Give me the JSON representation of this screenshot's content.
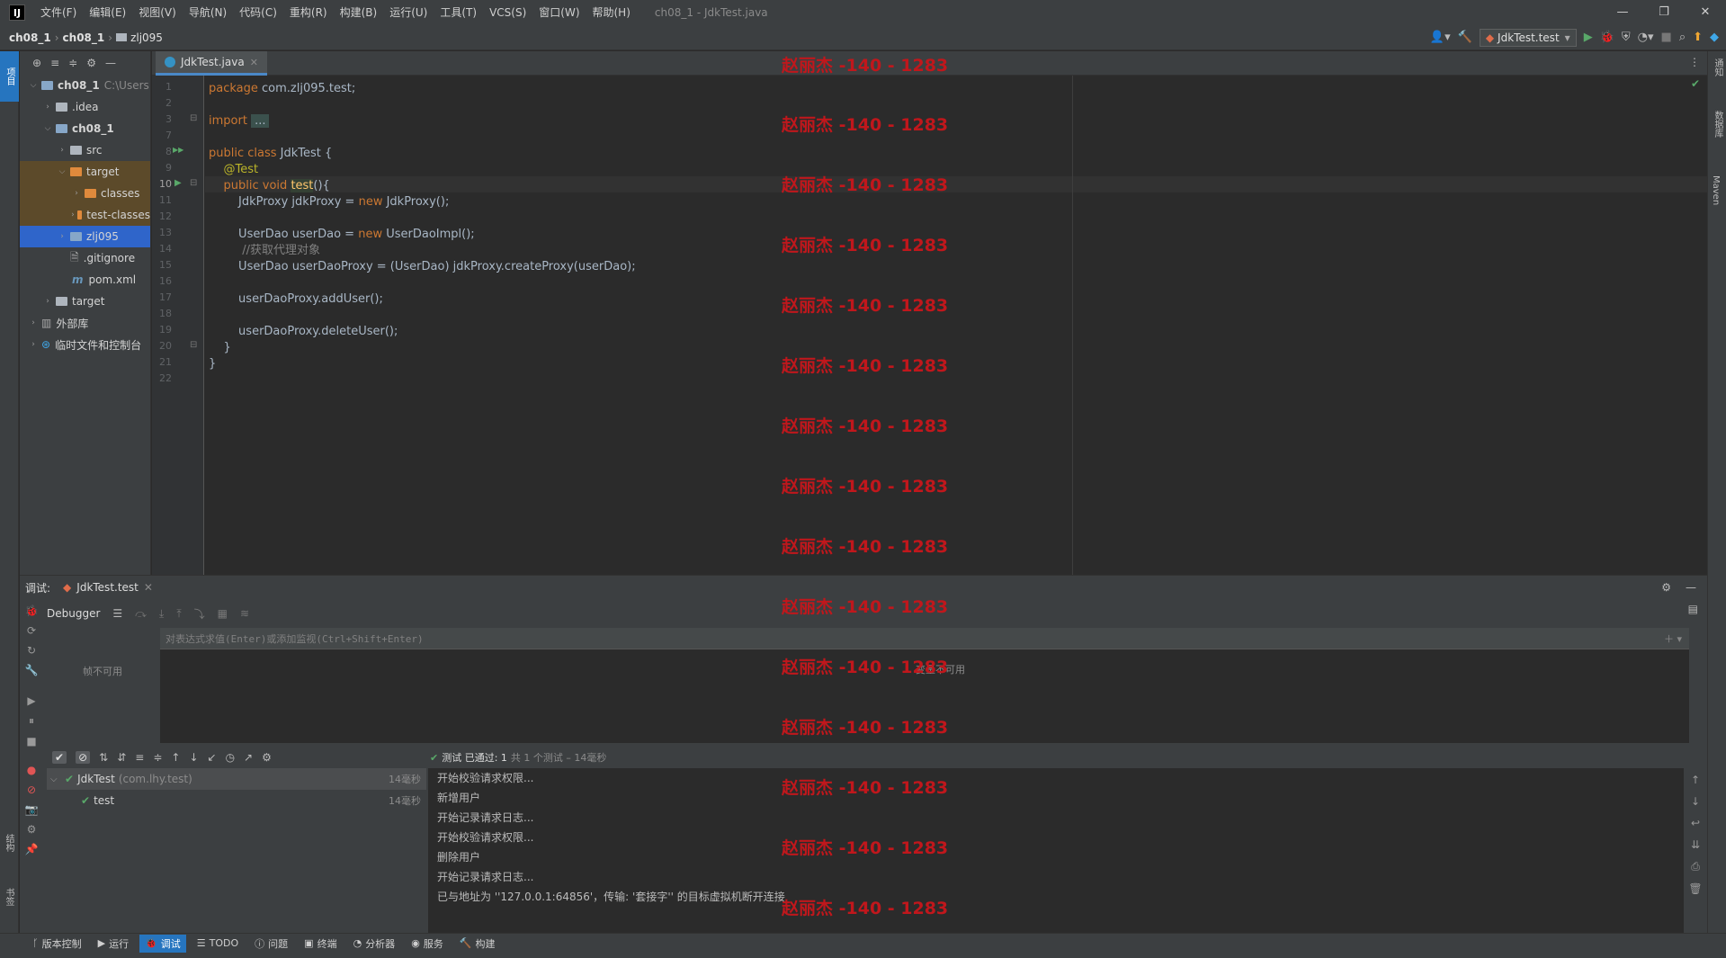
{
  "menu": {
    "items": [
      "文件(F)",
      "编辑(E)",
      "视图(V)",
      "导航(N)",
      "代码(C)",
      "重构(R)",
      "构建(B)",
      "运行(U)",
      "工具(T)",
      "VCS(S)",
      "窗口(W)",
      "帮助(H)"
    ],
    "window_title": "ch08_1 - JdkTest.java",
    "logo_text": "IJ"
  },
  "navbar": {
    "crumbs": [
      "ch08_1",
      "ch08_1",
      "zlj095"
    ],
    "run_config": "JdkTest.test"
  },
  "left_stripe": {
    "project_tab": "项目",
    "structure_tab": "结构",
    "bookmarks_tab": "书签"
  },
  "right_stripe": {
    "notifications": "通知",
    "database": "数据库",
    "maven": "Maven"
  },
  "project_tree": [
    {
      "label": "ch08_1",
      "hint": "C:\\Users",
      "depth": 0,
      "arrow": "v",
      "color": "blue",
      "bold": true
    },
    {
      "label": ".idea",
      "depth": 1,
      "arrow": ">",
      "color": "gray"
    },
    {
      "label": "ch08_1",
      "depth": 1,
      "arrow": "v",
      "color": "blue",
      "bold": true
    },
    {
      "label": "src",
      "depth": 2,
      "arrow": ">",
      "color": "gray"
    },
    {
      "label": "target",
      "depth": 2,
      "arrow": "v",
      "color": "orange",
      "excluded": true
    },
    {
      "label": "classes",
      "depth": 3,
      "arrow": ">",
      "color": "orange",
      "excluded": true
    },
    {
      "label": "test-classes",
      "depth": 3,
      "arrow": ">",
      "color": "orange",
      "excluded": true
    },
    {
      "label": "zlj095",
      "depth": 2,
      "arrow": ">",
      "color": "blue",
      "selected": true
    },
    {
      "label": ".gitignore",
      "depth": 2,
      "arrow": "",
      "color": "file"
    },
    {
      "label": "pom.xml",
      "depth": 2,
      "arrow": "",
      "color": "maven"
    },
    {
      "label": "target",
      "depth": 1,
      "arrow": ">",
      "color": "gray"
    },
    {
      "label": "外部库",
      "depth": 0,
      "arrow": ">",
      "color": "lib"
    },
    {
      "label": "临时文件和控制台",
      "depth": 0,
      "arrow": ">",
      "color": "scratch"
    }
  ],
  "editor": {
    "tab_label": "JdkTest.java",
    "lines": [
      {
        "n": "1",
        "html": "<span class=\"kw\">package</span> com.zlj095.test;"
      },
      {
        "n": "2",
        "html": ""
      },
      {
        "n": "3",
        "html": "<span class=\"kw\">import</span> <span class=\"fold-box\">...</span>"
      },
      {
        "n": "7",
        "html": ""
      },
      {
        "n": "8",
        "html": "<span class=\"kw\">public class</span> JdkTest {"
      },
      {
        "n": "9",
        "html": "    <span class=\"ann\">@Test</span>"
      },
      {
        "n": "10",
        "html": "    <span class=\"kw\">public void</span> <span class=\"fn\">test</span>(){"
      },
      {
        "n": "11",
        "html": "        JdkProxy jdkProxy = <span class=\"kw\">new</span> JdkProxy();"
      },
      {
        "n": "12",
        "html": ""
      },
      {
        "n": "13",
        "html": "        UserDao userDao = <span class=\"kw\">new</span> UserDaoImpl();"
      },
      {
        "n": "14",
        "html": "         <span class=\"cm\">//获取代理对象</span>"
      },
      {
        "n": "15",
        "html": "        UserDao userDaoProxy = (UserDao) jdkProxy.createProxy(userDao);"
      },
      {
        "n": "16",
        "html": ""
      },
      {
        "n": "17",
        "html": "        userDaoProxy.addUser();"
      },
      {
        "n": "18",
        "html": ""
      },
      {
        "n": "19",
        "html": "        userDaoProxy.deleteUser();"
      },
      {
        "n": "20",
        "html": "    }"
      },
      {
        "n": "21",
        "html": "}"
      },
      {
        "n": "22",
        "html": ""
      }
    ]
  },
  "watermark": "赵丽杰 -140 - 1283",
  "debug": {
    "title": "调试:",
    "session_tab": "JdkTest.test",
    "debugger_label": "Debugger",
    "frames_unavailable": "帧不可用",
    "eval_placeholder": "对表达式求值(Enter)或添加监视(Ctrl+Shift+Enter)",
    "vars_unavailable": "变量不可用",
    "test_status_main": "测试 已通过: 1",
    "test_status_detail": "共 1 个测试 – 14毫秒",
    "test_tree": [
      {
        "label": "JdkTest",
        "pkg": "(com.lhy.test)",
        "time": "14毫秒",
        "depth": 0
      },
      {
        "label": "test",
        "pkg": "",
        "time": "14毫秒",
        "depth": 1
      }
    ],
    "console_lines": [
      "开始校验请求权限...",
      "新增用户",
      "开始记录请求日志...",
      "开始校验请求权限...",
      "删除用户",
      "开始记录请求日志...",
      "已与地址为 ''127.0.0.1:64856'，传输: '套接字'' 的目标虚拟机断开连接"
    ]
  },
  "bottom_tools": [
    {
      "label": "版本控制",
      "icon": "branch-icon"
    },
    {
      "label": "运行",
      "icon": "run-icon"
    },
    {
      "label": "调试",
      "icon": "debug-icon",
      "active": true
    },
    {
      "label": "TODO",
      "icon": "list-icon"
    },
    {
      "label": "问题",
      "icon": "problems-icon"
    },
    {
      "label": "终端",
      "icon": "terminal-icon"
    },
    {
      "label": "分析器",
      "icon": "profiler-icon"
    },
    {
      "label": "服务",
      "icon": "services-icon"
    },
    {
      "label": "构建",
      "icon": "build-icon"
    }
  ],
  "colors": {
    "accent": "#2675bf",
    "success": "#59a869",
    "watermark": "#c0171c"
  }
}
